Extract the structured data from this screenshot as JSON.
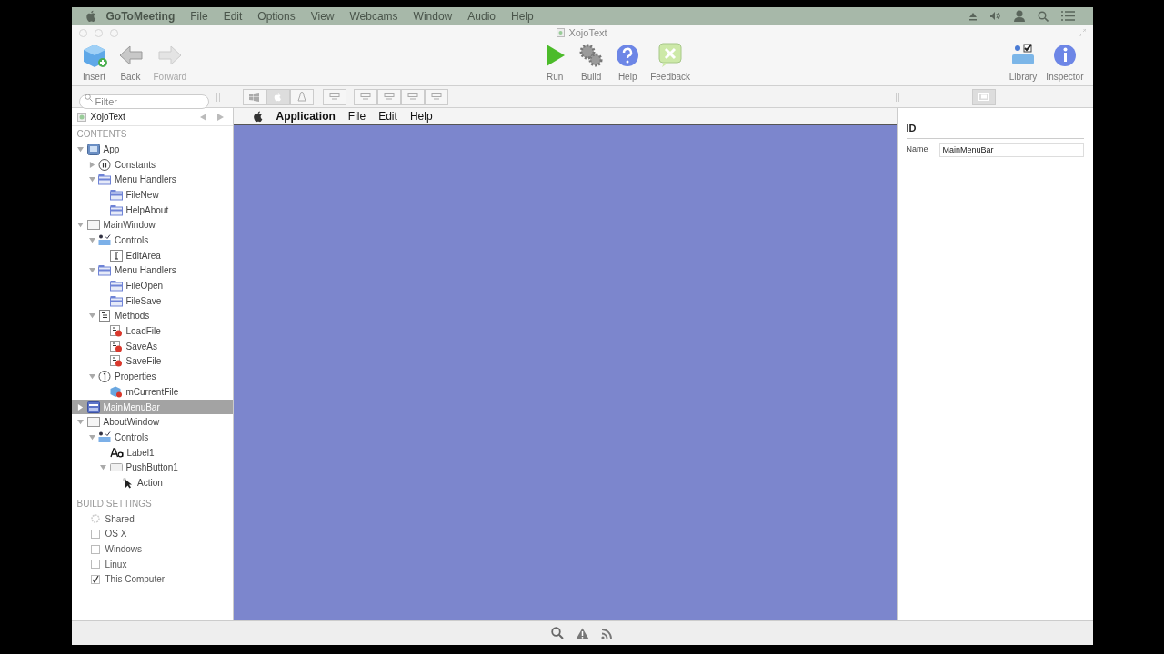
{
  "menu_bar": {
    "app_name": "GoToMeeting",
    "items": [
      "File",
      "Edit",
      "Options",
      "View",
      "Webcams",
      "Window",
      "Audio",
      "Help"
    ]
  },
  "window": {
    "title": "XojoText"
  },
  "toolbar": {
    "left": [
      {
        "kind": "insert",
        "label": "Insert",
        "disabled": false
      },
      {
        "kind": "back",
        "label": "Back",
        "disabled": false
      },
      {
        "kind": "forward",
        "label": "Forward",
        "disabled": true
      }
    ],
    "center": [
      {
        "kind": "run",
        "label": "Run",
        "disabled": false
      },
      {
        "kind": "build",
        "label": "Build",
        "disabled": false
      },
      {
        "kind": "help",
        "label": "Help",
        "disabled": false
      },
      {
        "kind": "feedback",
        "label": "Feedback",
        "disabled": false
      }
    ],
    "right": [
      {
        "kind": "library",
        "label": "Library",
        "disabled": false
      },
      {
        "kind": "inspector",
        "label": "Inspector",
        "disabled": false
      }
    ]
  },
  "filter": {
    "placeholder": "Filter"
  },
  "platform_buttons": [
    {
      "kind": "windows",
      "selected": false
    },
    {
      "kind": "apple",
      "selected": true
    },
    {
      "kind": "linux",
      "selected": false
    }
  ],
  "navigator": {
    "project": "XojoText",
    "contents_header": "CONTENTS",
    "tree": [
      {
        "label": "App",
        "kind": "app",
        "expanded": true,
        "selected": false,
        "children": [
          {
            "label": "Constants",
            "kind": "constants",
            "expanded": false,
            "selected": false
          },
          {
            "label": "Menu Handlers",
            "kind": "folder",
            "expanded": true,
            "selected": false,
            "children": [
              {
                "label": "FileNew",
                "kind": "folder",
                "selected": false
              },
              {
                "label": "HelpAbout",
                "kind": "folder",
                "selected": false
              }
            ]
          }
        ]
      },
      {
        "label": "MainWindow",
        "kind": "window",
        "expanded": true,
        "selected": false,
        "children": [
          {
            "label": "Controls",
            "kind": "controls",
            "expanded": true,
            "selected": false,
            "children": [
              {
                "label": "EditArea",
                "kind": "textarea",
                "selected": false
              }
            ]
          },
          {
            "label": "Menu Handlers",
            "kind": "folder",
            "expanded": true,
            "selected": false,
            "children": [
              {
                "label": "FileOpen",
                "kind": "folder",
                "selected": false
              },
              {
                "label": "FileSave",
                "kind": "folder",
                "selected": false
              }
            ]
          },
          {
            "label": "Methods",
            "kind": "methods",
            "expanded": true,
            "selected": false,
            "children": [
              {
                "label": "LoadFile",
                "kind": "method",
                "selected": false
              },
              {
                "label": "SaveAs",
                "kind": "method",
                "selected": false
              },
              {
                "label": "SaveFile",
                "kind": "method",
                "selected": false
              }
            ]
          },
          {
            "label": "Properties",
            "kind": "properties",
            "expanded": true,
            "selected": false,
            "children": [
              {
                "label": "mCurrentFile",
                "kind": "property",
                "selected": false
              }
            ]
          }
        ]
      },
      {
        "label": "MainMenuBar",
        "kind": "menubar",
        "expanded": false,
        "selected": true
      },
      {
        "label": "AboutWindow",
        "kind": "window",
        "expanded": true,
        "selected": false,
        "children": [
          {
            "label": "Controls",
            "kind": "controls",
            "expanded": true,
            "selected": false,
            "children": [
              {
                "label": "Label1",
                "kind": "label",
                "selected": false
              },
              {
                "label": "PushButton1",
                "kind": "pushbutton",
                "expanded": true,
                "selected": false,
                "children": [
                  {
                    "label": "Action",
                    "kind": "event",
                    "selected": false
                  }
                ]
              }
            ]
          }
        ]
      }
    ],
    "build_header": "BUILD SETTINGS",
    "build_settings": [
      {
        "kind": "shared",
        "label": "Shared"
      },
      {
        "kind": "checkbox",
        "label": "OS X",
        "checked": false
      },
      {
        "kind": "checkbox",
        "label": "Windows",
        "checked": false
      },
      {
        "kind": "checkbox",
        "label": "Linux",
        "checked": false
      },
      {
        "kind": "checkbox",
        "label": "This Computer",
        "checked": true
      }
    ]
  },
  "editor": {
    "menu_items": [
      {
        "label": "Application",
        "bold": true
      },
      {
        "label": "File",
        "bold": false
      },
      {
        "label": "Edit",
        "bold": false
      },
      {
        "label": "Help",
        "bold": false
      }
    ]
  },
  "inspector": {
    "section": "ID",
    "fields": [
      {
        "label": "Name",
        "value": "MainMenuBar"
      }
    ]
  }
}
